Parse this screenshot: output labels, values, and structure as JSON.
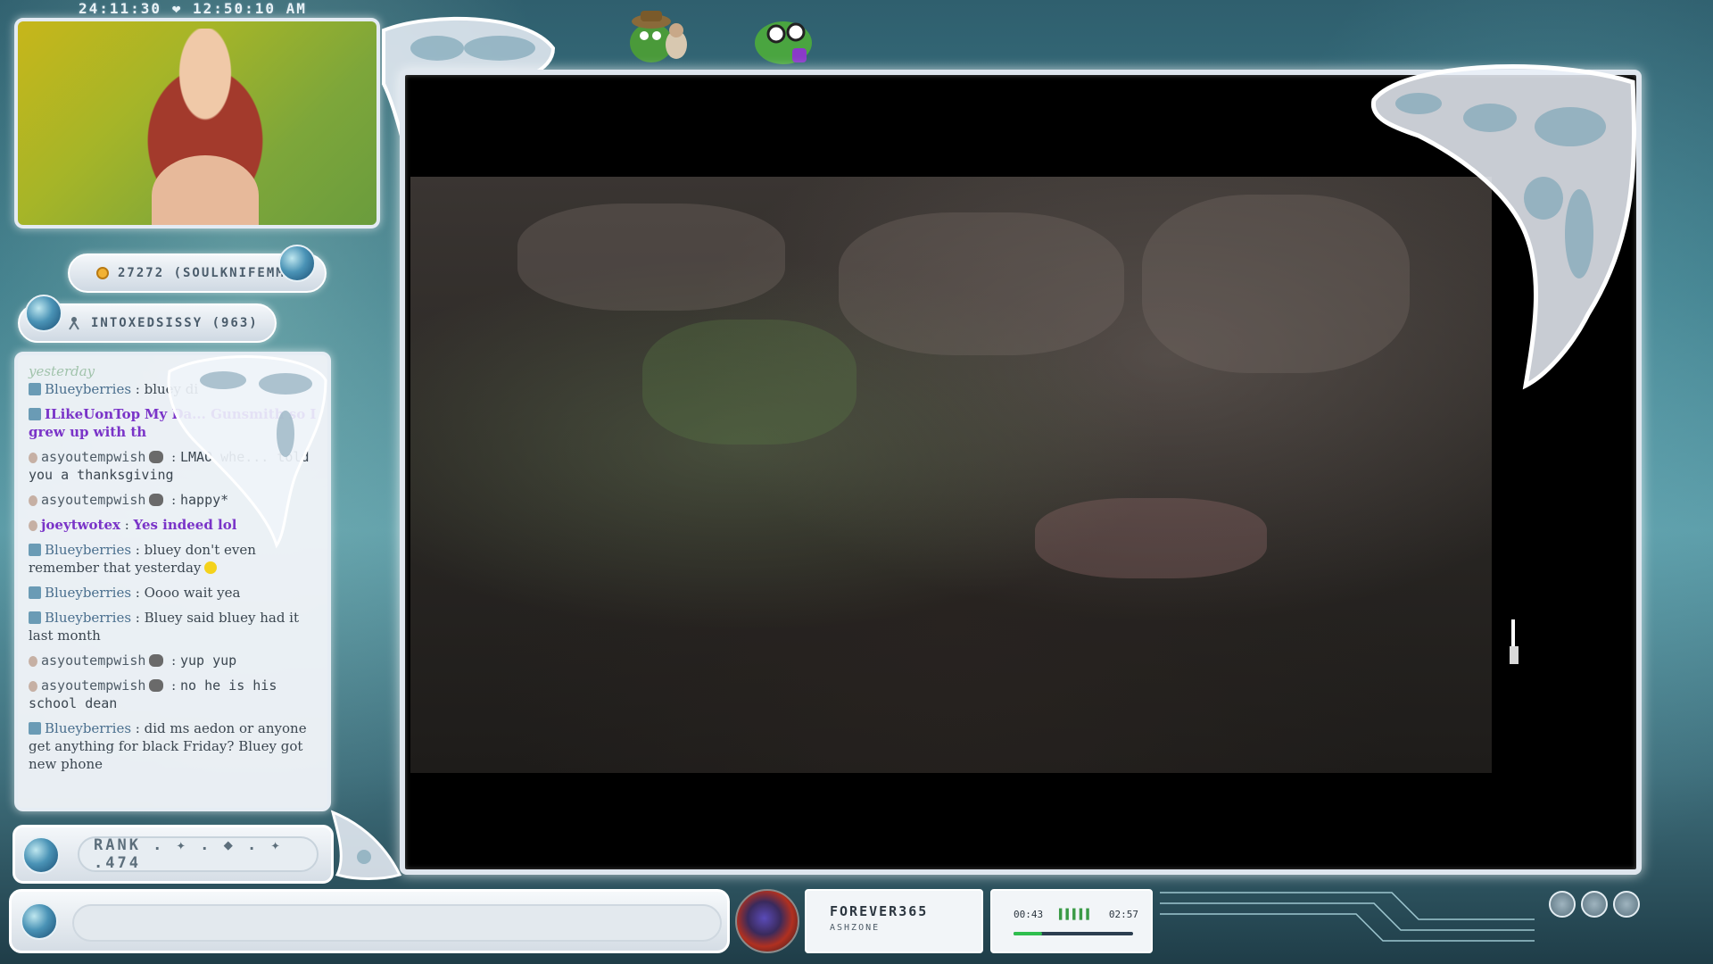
{
  "overlay": {
    "clock": "24:11:30 ❤ 12:50:10 AM",
    "latest_sub": "27272 (SOULKNIFEMMC)",
    "latest_follow": "INTOXEDSISSY (963)",
    "rank_text": "RANK . ✦ . ◆ . ✦ .474"
  },
  "chat": {
    "faded_top": "yesterday",
    "messages": [
      {
        "user": "Blueyberries",
        "sep": " : ",
        "text": "bluey di",
        "style": "normal",
        "badge": "square"
      },
      {
        "user": "ILikeUonTop",
        "sep": " ",
        "text": "My Da... Gunsmith so I grew up with th",
        "style": "purple",
        "badge": "square"
      },
      {
        "user": "asyoutempwish",
        "sep": " : ",
        "text": "LMAO whe... told you a thanksgiving",
        "style": "mono",
        "badge": "small"
      },
      {
        "user": "asyoutempwish",
        "sep": " : ",
        "text": "happy*",
        "style": "mono",
        "badge": "small"
      },
      {
        "user": "joeytwotex",
        "sep": " : ",
        "text": "Yes indeed lol",
        "style": "purple",
        "badge": "small"
      },
      {
        "user": "Blueyberries",
        "sep": " : ",
        "text": "bluey don't even remember that yesterday",
        "style": "normal",
        "badge": "square",
        "emote": "yellow"
      },
      {
        "user": "Blueyberries",
        "sep": " : ",
        "text": "Oooo wait yea",
        "style": "normal",
        "badge": "square"
      },
      {
        "user": "Blueyberries",
        "sep": " : ",
        "text": "Bluey said bluey had it last month",
        "style": "normal",
        "badge": "square"
      },
      {
        "user": "asyoutempwish",
        "sep": " : ",
        "text": "yup yup",
        "style": "mono",
        "badge": "small"
      },
      {
        "user": "asyoutempwish",
        "sep": " : ",
        "text": "no he is his school dean",
        "style": "mono",
        "badge": "small"
      },
      {
        "user": "Blueyberries",
        "sep": " : ",
        "text": "did ms aedon or anyone get anything for black Friday? Bluey got new phone",
        "style": "normal",
        "badge": "square"
      }
    ]
  },
  "music": {
    "title": "FOREVER365",
    "artist": "ASHZONE",
    "elapsed": "00:43",
    "ticks": "▌▌▌▌▌",
    "total": "02:57",
    "progress_fraction": 0.24
  },
  "colors": {
    "frame": "#dfe6ee",
    "accent_purple": "#7a34c8",
    "accent_blue": "#4a6f8e",
    "progress": "#2fbf4e"
  },
  "icons": [
    "coin-icon",
    "gem-icon",
    "follow-icon",
    "gear-icon",
    "sun-icon",
    "menu-icon"
  ]
}
